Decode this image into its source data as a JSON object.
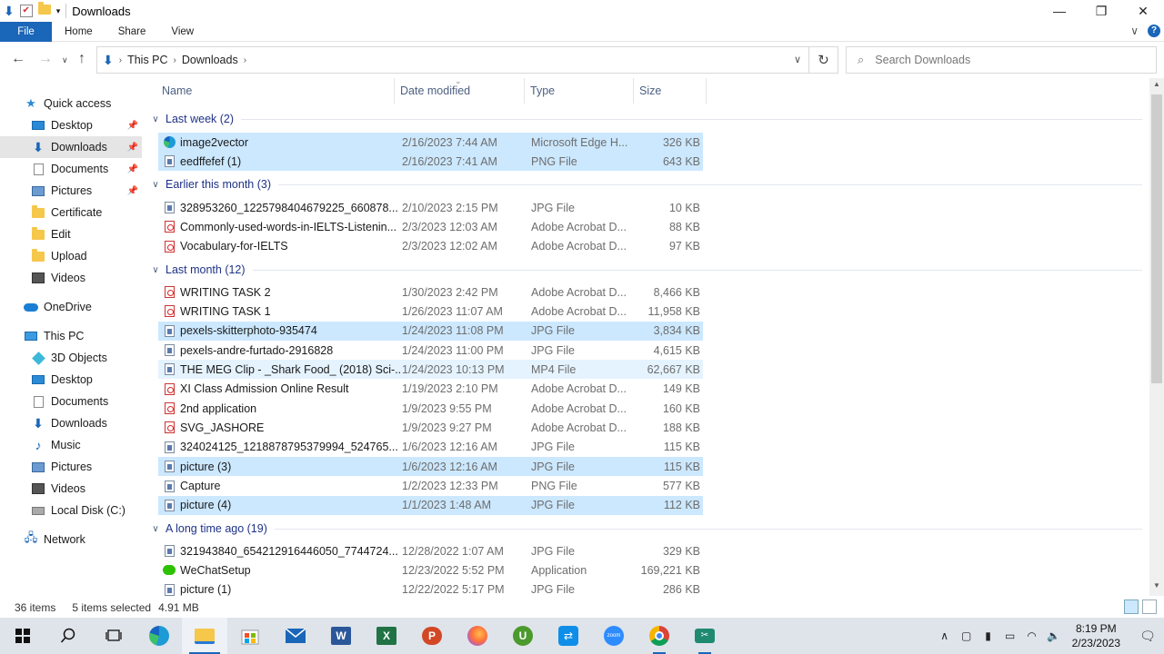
{
  "window": {
    "title": "Downloads",
    "controls": {
      "minimize": "—",
      "maximize": "❐",
      "close": "✕"
    }
  },
  "ribbon": {
    "tabs": [
      "File",
      "Home",
      "Share",
      "View"
    ],
    "expand_icon": "∨",
    "help": "?"
  },
  "address": {
    "crumbs": [
      "This PC",
      "Downloads"
    ],
    "search_placeholder": "Search Downloads"
  },
  "nav": {
    "quick_access": "Quick access",
    "quick": [
      {
        "label": "Desktop",
        "icon": "desktop-icon",
        "pinned": true
      },
      {
        "label": "Downloads",
        "icon": "downloads-icon",
        "pinned": true,
        "selected": true
      },
      {
        "label": "Documents",
        "icon": "documents-icon",
        "pinned": true
      },
      {
        "label": "Pictures",
        "icon": "pictures-icon",
        "pinned": true
      },
      {
        "label": "Certificate",
        "icon": "folder-icon"
      },
      {
        "label": "Edit",
        "icon": "folder-icon"
      },
      {
        "label": "Upload",
        "icon": "folder-icon"
      },
      {
        "label": "Videos",
        "icon": "videos-icon"
      }
    ],
    "onedrive": "OneDrive",
    "this_pc": "This PC",
    "pc": [
      {
        "label": "3D Objects",
        "icon": "3d-objects-icon"
      },
      {
        "label": "Desktop",
        "icon": "desktop-icon"
      },
      {
        "label": "Documents",
        "icon": "documents-icon"
      },
      {
        "label": "Downloads",
        "icon": "downloads-icon"
      },
      {
        "label": "Music",
        "icon": "music-icon"
      },
      {
        "label": "Pictures",
        "icon": "pictures-icon"
      },
      {
        "label": "Videos",
        "icon": "videos-icon"
      },
      {
        "label": "Local Disk (C:)",
        "icon": "disk-icon"
      }
    ],
    "network": "Network"
  },
  "columns": [
    "Name",
    "Date modified",
    "Type",
    "Size"
  ],
  "groups": [
    {
      "title": "Last week (2)",
      "files": [
        {
          "name": "image2vector",
          "date": "2/16/2023 7:44 AM",
          "type": "Microsoft Edge H...",
          "size": "326 KB",
          "icon": "edge",
          "state": "sel"
        },
        {
          "name": "eedffefef (1)",
          "date": "2/16/2023 7:41 AM",
          "type": "PNG File",
          "size": "643 KB",
          "icon": "doc",
          "state": "sel"
        }
      ]
    },
    {
      "title": "Earlier this month (3)",
      "files": [
        {
          "name": "328953260_1225798404679225_660878...",
          "date": "2/10/2023 2:15 PM",
          "type": "JPG File",
          "size": "10 KB",
          "icon": "doc"
        },
        {
          "name": "Commonly-used-words-in-IELTS-Listenin...",
          "date": "2/3/2023 12:03 AM",
          "type": "Adobe Acrobat D...",
          "size": "88 KB",
          "icon": "pdf"
        },
        {
          "name": "Vocabulary-for-IELTS",
          "date": "2/3/2023 12:02 AM",
          "type": "Adobe Acrobat D...",
          "size": "97 KB",
          "icon": "pdf"
        }
      ]
    },
    {
      "title": "Last month (12)",
      "files": [
        {
          "name": "WRITING TASK 2",
          "date": "1/30/2023 2:42 PM",
          "type": "Adobe Acrobat D...",
          "size": "8,466 KB",
          "icon": "pdf"
        },
        {
          "name": "WRITING TASK 1",
          "date": "1/26/2023 11:07 AM",
          "type": "Adobe Acrobat D...",
          "size": "11,958 KB",
          "icon": "pdf"
        },
        {
          "name": "pexels-skitterphoto-935474",
          "date": "1/24/2023 11:08 PM",
          "type": "JPG File",
          "size": "3,834 KB",
          "icon": "doc",
          "state": "sel"
        },
        {
          "name": "pexels-andre-furtado-2916828",
          "date": "1/24/2023 11:00 PM",
          "type": "JPG File",
          "size": "4,615 KB",
          "icon": "doc"
        },
        {
          "name": "THE MEG Clip - _Shark Food_ (2018) Sci-...",
          "date": "1/24/2023 10:13 PM",
          "type": "MP4 File",
          "size": "62,667 KB",
          "icon": "doc",
          "state": "hov"
        },
        {
          "name": "XI Class Admission Online Result",
          "date": "1/19/2023 2:10 PM",
          "type": "Adobe Acrobat D...",
          "size": "149 KB",
          "icon": "pdf"
        },
        {
          "name": "2nd  application",
          "date": "1/9/2023 9:55 PM",
          "type": "Adobe Acrobat D...",
          "size": "160 KB",
          "icon": "pdf"
        },
        {
          "name": "SVG_JASHORE",
          "date": "1/9/2023 9:27 PM",
          "type": "Adobe Acrobat D...",
          "size": "188 KB",
          "icon": "pdf"
        },
        {
          "name": "324024125_1218878795379994_524765...",
          "date": "1/6/2023 12:16 AM",
          "type": "JPG File",
          "size": "115 KB",
          "icon": "doc"
        },
        {
          "name": "picture (3)",
          "date": "1/6/2023 12:16 AM",
          "type": "JPG File",
          "size": "115 KB",
          "icon": "doc",
          "state": "sel"
        },
        {
          "name": "Capture",
          "date": "1/2/2023 12:33 PM",
          "type": "PNG File",
          "size": "577 KB",
          "icon": "doc"
        },
        {
          "name": "picture (4)",
          "date": "1/1/2023 1:48 AM",
          "type": "JPG File",
          "size": "112 KB",
          "icon": "doc",
          "state": "sel"
        }
      ]
    },
    {
      "title": "A long time ago (19)",
      "files": [
        {
          "name": "321943840_654212916446050_7744724...",
          "date": "12/28/2022 1:07 AM",
          "type": "JPG File",
          "size": "329 KB",
          "icon": "doc"
        },
        {
          "name": "WeChatSetup",
          "date": "12/23/2022 5:52 PM",
          "type": "Application",
          "size": "169,221 KB",
          "icon": "wechat"
        },
        {
          "name": "picture (1)",
          "date": "12/22/2022 5:17 PM",
          "type": "JPG File",
          "size": "286 KB",
          "icon": "doc"
        }
      ]
    }
  ],
  "status": {
    "items": "36 items",
    "selected": "5 items selected",
    "size": "4.91 MB"
  },
  "taskbar": {
    "apps": [
      "start-icon",
      "search-icon",
      "task-view-icon",
      "edge-icon",
      "file-explorer-icon",
      "store-icon",
      "mail-icon",
      "word-icon",
      "excel-icon",
      "powerpoint-icon",
      "firefox-icon",
      "utorrent-icon",
      "teamviewer-icon",
      "zoom-icon",
      "chrome-icon",
      "snipping-tool-icon"
    ],
    "time": "8:19 PM",
    "date": "2/23/2023"
  },
  "colors": {
    "accent": "#1a66b8",
    "selection": "#cce8ff",
    "group_title": "#1e3287"
  }
}
